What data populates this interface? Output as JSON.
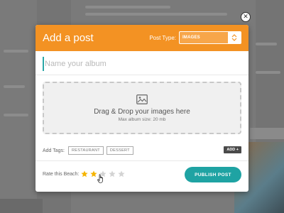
{
  "modal": {
    "title": "Add a post",
    "post_type_label": "Post Type:",
    "post_type_value": "IMAGES",
    "close_icon": "close-icon",
    "album_placeholder": "Name your album",
    "album_value": "",
    "drop_zone": {
      "icon": "image-icon",
      "title": "Drag & Drop your images here",
      "subtitle": "Max album size: 20 mb"
    },
    "tags": {
      "label": "Add Tags:",
      "items": [
        "RESTAURANT",
        "DESSERT"
      ],
      "add_label": "ADD +"
    },
    "rating": {
      "label": "Rate this Beach:",
      "value": 2,
      "max": 5
    },
    "publish_label": "PUBLISH POST"
  },
  "colors": {
    "header": "#f39223",
    "accent": "#1fa3a3",
    "star_filled": "#f5b400",
    "star_empty": "#d3d3d3"
  }
}
